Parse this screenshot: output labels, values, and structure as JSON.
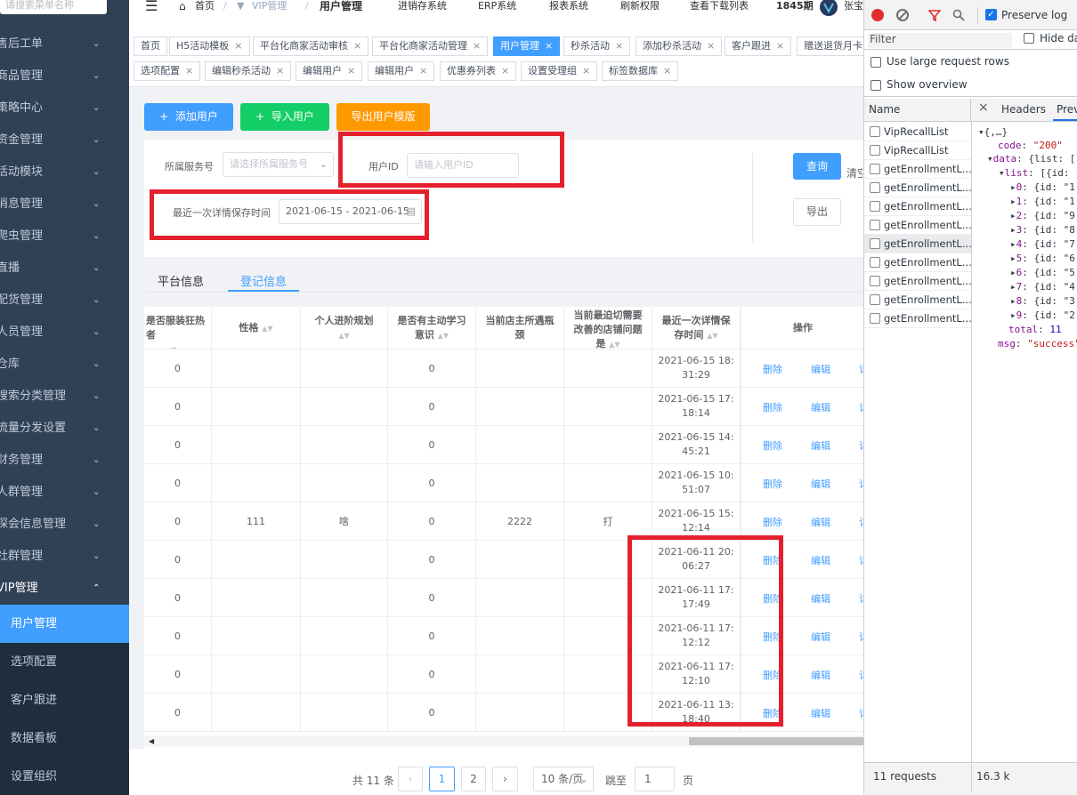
{
  "sidebar": {
    "search_placeholder": "请搜索菜单名称",
    "items": [
      {
        "label": "售后工单"
      },
      {
        "label": "商品管理"
      },
      {
        "label": "策略中心"
      },
      {
        "label": "资金管理"
      },
      {
        "label": "活动模块"
      },
      {
        "label": "消息管理"
      },
      {
        "label": "爬虫管理"
      },
      {
        "label": "直播"
      },
      {
        "label": "配货管理"
      },
      {
        "label": "人员管理"
      },
      {
        "label": "仓库"
      },
      {
        "label": "搜索分类管理"
      },
      {
        "label": "流量分发设置"
      },
      {
        "label": "财务管理"
      },
      {
        "label": "人群管理"
      },
      {
        "label": "探会信息管理"
      },
      {
        "label": "社群管理"
      },
      {
        "label": "VIP管理"
      }
    ],
    "sub_items": [
      {
        "label": "用户管理"
      },
      {
        "label": "选项配置"
      },
      {
        "label": "客户跟进"
      },
      {
        "label": "数据看板"
      },
      {
        "label": "设置组织"
      }
    ]
  },
  "topnav": {
    "breadcrumb": [
      "首页",
      "VIP管理",
      "用户管理"
    ],
    "links": [
      "进销存系统",
      "ERP系统",
      "报表系统",
      "刷新权限",
      "查看下载列表"
    ],
    "period": "1845期",
    "user": "张宝"
  },
  "tabs": {
    "row1": [
      "首页",
      "H5活动模板",
      "平台化商家活动审核",
      "平台化商家活动管理",
      "用户管理",
      "秒杀活动",
      "添加秒杀活动",
      "客户跟进",
      "赠送退货月卡"
    ],
    "row2": [
      "选项配置",
      "编辑秒杀活动",
      "编辑用户",
      "编辑用户",
      "优惠券列表",
      "设置受理组",
      "标签数据库"
    ]
  },
  "actions": {
    "add_user": "添加用户",
    "import_user": "导入用户",
    "export_template": "导出用户模版"
  },
  "filter": {
    "service_label": "所属服务号",
    "service_placeholder": "请选择所属服务号",
    "userid_label": "用户ID",
    "userid_placeholder": "请输入用户ID",
    "date_label": "最近一次详情保存时间",
    "date_value": "2021-06-15 - 2021-06-15",
    "query_btn": "查询",
    "clear_btn": "清空",
    "export_btn": "导出"
  },
  "subtabs": [
    "平台信息",
    "登记信息"
  ],
  "table": {
    "headers": [
      "是否服装狂热者",
      "性格",
      "个人进阶规划",
      "是否有主动学习意识",
      "当前店主所遇瓶颈",
      "当前最迫切需要改善的店铺问题是",
      "最近一次详情保存时间",
      "操作"
    ],
    "rows": [
      [
        "0",
        "",
        "",
        "0",
        "",
        "",
        "2021-06-15 18:31:29"
      ],
      [
        "0",
        "",
        "",
        "0",
        "",
        "",
        "2021-06-15 17:18:14"
      ],
      [
        "0",
        "",
        "",
        "0",
        "",
        "",
        "2021-06-15 14:45:21"
      ],
      [
        "0",
        "",
        "",
        "0",
        "",
        "",
        "2021-06-15 10:51:07"
      ],
      [
        "0",
        "111",
        "啥",
        "0",
        "2222",
        "打",
        "2021-06-15 15:12:14"
      ],
      [
        "0",
        "",
        "",
        "0",
        "",
        "",
        "2021-06-11 20:06:27"
      ],
      [
        "0",
        "",
        "",
        "0",
        "",
        "",
        "2021-06-11 17:17:49"
      ],
      [
        "0",
        "",
        "",
        "0",
        "",
        "",
        "2021-06-11 17:12:12"
      ],
      [
        "0",
        "",
        "",
        "0",
        "",
        "",
        "2021-06-11 17:12:10"
      ],
      [
        "0",
        "",
        "",
        "0",
        "",
        "",
        "2021-06-11 13:18:40"
      ]
    ],
    "delete_label": "删除",
    "edit_label": "编辑",
    "more_label": "详"
  },
  "pager": {
    "total": "共 11 条",
    "pages": [
      "1",
      "2"
    ],
    "size": "10 条/页",
    "jump_label": "跳至",
    "jump_value": "1",
    "page_unit": "页"
  },
  "devtools": {
    "preserve_log": "Preserve log",
    "filter_placeholder": "Filter",
    "hide_data": "Hide data",
    "large_rows": "Use large request rows",
    "overview": "Show overview",
    "name_col": "Name",
    "headers_tab": "Headers",
    "preview_tab": "Prev",
    "requests": [
      "VipRecallList",
      "VipRecallList",
      "getEnrollmentL...",
      "getEnrollmentL...",
      "getEnrollmentL...",
      "getEnrollmentL...",
      "getEnrollmentL...",
      "getEnrollmentL...",
      "getEnrollmentL...",
      "getEnrollmentL...",
      "getEnrollmentL..."
    ],
    "status": "11 requests",
    "size": "16.3 k",
    "preview": {
      "root": "{,…}",
      "code_key": "code",
      "code_val": "\"200\"",
      "data_key": "data",
      "data_val": "{list: [",
      "list_key": "list",
      "list_val": "[{id:",
      "items": [
        {
          "k": "0",
          "v": "{id: \"1"
        },
        {
          "k": "1",
          "v": "{id: \"1"
        },
        {
          "k": "2",
          "v": "{id: \"9"
        },
        {
          "k": "3",
          "v": "{id: \"8"
        },
        {
          "k": "4",
          "v": "{id: \"7"
        },
        {
          "k": "5",
          "v": "{id: \"6"
        },
        {
          "k": "6",
          "v": "{id: \"5"
        },
        {
          "k": "7",
          "v": "{id: \"4"
        },
        {
          "k": "8",
          "v": "{id: \"3"
        },
        {
          "k": "9",
          "v": "{id: \"2"
        }
      ],
      "total_key": "total",
      "total_val": "11",
      "msg_key": "msg",
      "msg_val": "\"success\""
    }
  },
  "colors": {
    "sidebar_bg": "#304156",
    "primary": "#409eff",
    "success": "#13ce66",
    "warning": "#ff9900",
    "highlight": "#e5202d"
  }
}
